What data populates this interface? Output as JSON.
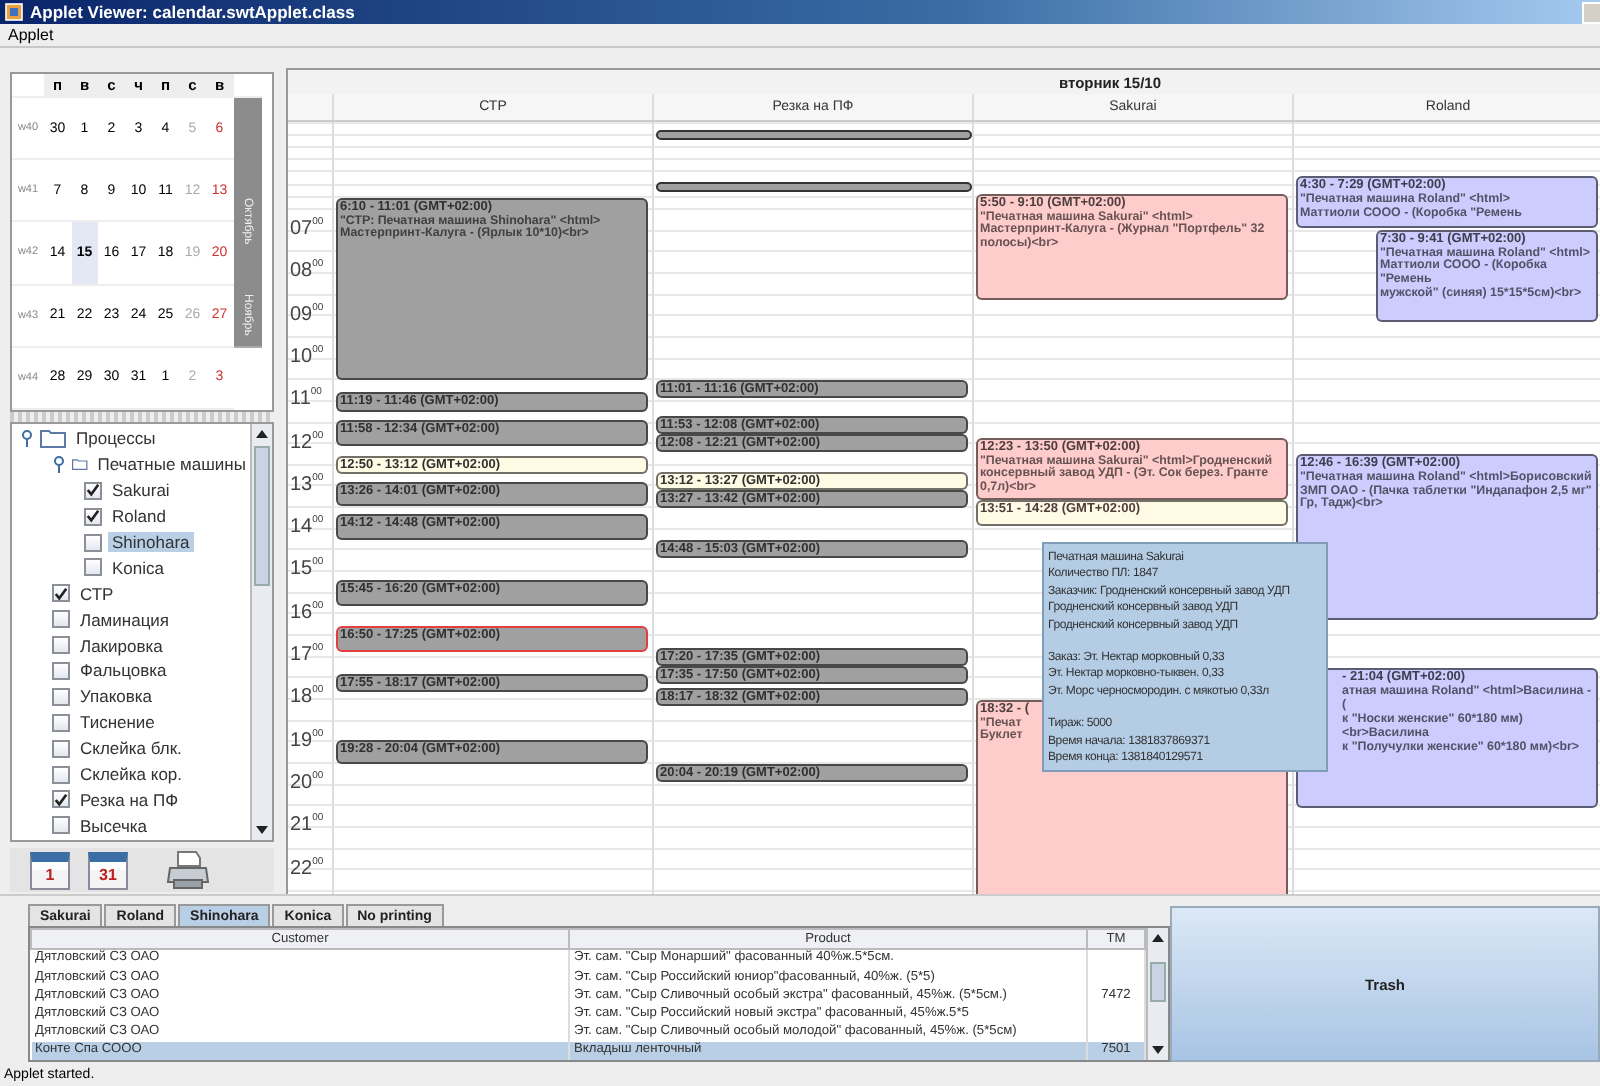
{
  "window": {
    "title": "Applet Viewer: calendar.swtApplet.class"
  },
  "menu": [
    "Applet"
  ],
  "calendar": {
    "weekdays": [
      "п",
      "в",
      "с",
      "ч",
      "п",
      "с",
      "в"
    ],
    "weeks": [
      {
        "label": "w40",
        "days": [
          {
            "day": "30",
            "selected": false
          },
          {
            "day": "1",
            "selected": false
          },
          {
            "day": "2",
            "selected": false
          },
          {
            "day": "3",
            "selected": false
          },
          {
            "day": "4",
            "selected": false
          },
          {
            "day": "5",
            "selected": false
          },
          {
            "day": "6",
            "selected": false
          }
        ]
      },
      {
        "label": "w41",
        "days": [
          {
            "day": "7",
            "selected": false
          },
          {
            "day": "8",
            "selected": false
          },
          {
            "day": "9",
            "selected": false
          },
          {
            "day": "10",
            "selected": false
          },
          {
            "day": "11",
            "selected": false
          },
          {
            "day": "12",
            "selected": false
          },
          {
            "day": "13",
            "selected": false
          }
        ]
      },
      {
        "label": "w42",
        "days": [
          {
            "day": "14",
            "selected": false
          },
          {
            "day": "15",
            "selected": true
          },
          {
            "day": "16",
            "selected": false
          },
          {
            "day": "17",
            "selected": false
          },
          {
            "day": "18",
            "selected": false
          },
          {
            "day": "19",
            "selected": false
          },
          {
            "day": "20",
            "selected": false
          }
        ]
      },
      {
        "label": "w43",
        "days": [
          {
            "day": "21",
            "selected": false
          },
          {
            "day": "22",
            "selected": false
          },
          {
            "day": "23",
            "selected": false
          },
          {
            "day": "24",
            "selected": false
          },
          {
            "day": "25",
            "selected": false
          },
          {
            "day": "26",
            "selected": false
          },
          {
            "day": "27",
            "selected": false
          }
        ]
      },
      {
        "label": "w44",
        "days": [
          {
            "day": "28",
            "selected": false
          },
          {
            "day": "29",
            "selected": false
          },
          {
            "day": "30",
            "selected": false
          },
          {
            "day": "31",
            "selected": false
          },
          {
            "day": "1",
            "selected": false
          },
          {
            "day": "2",
            "selected": false
          },
          {
            "day": "3",
            "selected": false
          }
        ]
      }
    ],
    "months": [
      {
        "label": "Октябрь"
      },
      {
        "label": "Ноябрь"
      }
    ]
  },
  "tree": {
    "items": [
      {
        "label": "Процессы",
        "kind": "folder",
        "expanded": true,
        "children": [
          {
            "label": "Печатные машины",
            "kind": "folder",
            "expanded": true,
            "children": [
              {
                "label": "Sakurai",
                "kind": "check",
                "checked": true,
                "selected": false
              },
              {
                "label": "Roland",
                "kind": "check",
                "checked": true,
                "selected": false
              },
              {
                "label": "Shinohara",
                "kind": "check",
                "checked": false,
                "selected": true
              },
              {
                "label": "Konica",
                "kind": "check",
                "checked": false,
                "selected": false
              }
            ]
          },
          {
            "label": "СТР",
            "kind": "check",
            "checked": true,
            "selected": false
          },
          {
            "label": "Ламинация",
            "kind": "check",
            "checked": false,
            "selected": false
          },
          {
            "label": "Лакировка",
            "kind": "check",
            "checked": false,
            "selected": false
          },
          {
            "label": "Фальцовка",
            "kind": "check",
            "checked": false,
            "selected": false
          },
          {
            "label": "Упаковка",
            "kind": "check",
            "checked": false,
            "selected": false
          },
          {
            "label": "Тиснение",
            "kind": "check",
            "checked": false,
            "selected": false
          },
          {
            "label": "Склейка блк.",
            "kind": "check",
            "checked": false,
            "selected": false
          },
          {
            "label": "Склейка кор.",
            "kind": "check",
            "checked": false,
            "selected": false
          },
          {
            "label": "Резка на ПФ",
            "kind": "check",
            "checked": true,
            "selected": false
          },
          {
            "label": "Высечка",
            "kind": "check",
            "checked": false,
            "selected": false
          }
        ]
      }
    ]
  },
  "toolbar": [
    {
      "kind": "calendar",
      "label": "1"
    },
    {
      "kind": "calendar",
      "label": "31"
    },
    {
      "kind": "printer"
    }
  ],
  "schedule": {
    "day": "вторник 15/10",
    "hours": [
      "07$^{00}$",
      "08$^{00}$",
      "09$^{00}$",
      "10$^{00}$",
      "11$^{00}$",
      "12$^{00}$",
      "13$^{00}$",
      "14$^{00}$",
      "15$^{00}$",
      "16$^{00}$",
      "17$^{00}$",
      "18$^{00}$",
      "19$^{00}$",
      "20$^{00}$",
      "21$^{00}$",
      "22$^{00}$"
    ],
    "columns": [
      {
        "title": "СТР",
        "color": "#a0a0a0",
        "events": [
          {
            "title": "6:10 - 11:01 (GMT+02:00)",
            "kind": "normal",
            "lines": [
              "\"СТР: Печатная машина Shinohara\" <html>",
              "Мастерпринт-Калуга - (Ярлык 10*10)<br>"
            ]
          },
          {
            "title": "11:19 - 11:46 (GMT+02:00)",
            "kind": "normal"
          },
          {
            "title": "11:58 - 12:34 (GMT+02:00)",
            "kind": "normal"
          },
          {
            "title": "12:50 - 13:12 (GMT+02:00)",
            "kind": "current"
          },
          {
            "title": "13:26 - 14:01 (GMT+02:00)",
            "kind": "normal"
          },
          {
            "title": "14:12 - 14:48 (GMT+02:00)",
            "kind": "normal"
          },
          {
            "title": "15:45 - 16:20 (GMT+02:00)",
            "kind": "normal"
          },
          {
            "title": "16:50 - 17:25 (GMT+02:00)",
            "kind": "warning"
          },
          {
            "title": "17:55 - 18:17 (GMT+02:00)",
            "kind": "normal"
          },
          {
            "title": "19:28 - 20:04 (GMT+02:00)",
            "kind": "normal"
          }
        ]
      },
      {
        "title": "Резка на ПФ",
        "color": "#a0a0a0",
        "markers": [
          {
            "kind": "bar"
          },
          {
            "kind": "bar"
          }
        ],
        "events": [
          {
            "title": "11:01 - 11:16 (GMT+02:00)",
            "kind": "normal"
          },
          {
            "title": "11:53 - 12:08 (GMT+02:00)",
            "kind": "normal"
          },
          {
            "title": "12:08 - 12:21 (GMT+02:00)",
            "kind": "normal"
          },
          {
            "title": "13:12 - 13:27 (GMT+02:00)",
            "kind": "current"
          },
          {
            "title": "13:27 - 13:42 (GMT+02:00)",
            "kind": "normal"
          },
          {
            "title": "14:48 - 15:03 (GMT+02:00)",
            "kind": "normal"
          },
          {
            "title": "17:20 - 17:35 (GMT+02:00)",
            "kind": "normal"
          },
          {
            "title": "17:35 - 17:50 (GMT+02:00)",
            "kind": "normal"
          },
          {
            "title": "18:17 - 18:32 (GMT+02:00)",
            "kind": "normal"
          },
          {
            "title": "20:04 - 20:19 (GMT+02:00)",
            "kind": "normal"
          }
        ]
      },
      {
        "title": "Sakurai",
        "color": "#ffcccc",
        "events": [
          {
            "title": "5:50 - 9:10 (GMT+02:00)",
            "kind": "normal",
            "lines": [
              "\"Печатная машина Sakurai\" <html>",
              "Мастерпринт-Калуга - (Журнал \"Портфель\" 32",
              "полосы)<br>"
            ]
          },
          {
            "title": "12:23 - 13:50 (GMT+02:00)",
            "kind": "normal",
            "lines": [
              "\"Печатная машина Sakurai\" <html>Гродненский",
              "консервный завод УДП - (Эт. Сок берез. Гранте",
              "0,7л)<br>"
            ]
          },
          {
            "title": "13:51 - 14:28 (GMT+02:00)",
            "kind": "current"
          },
          {
            "title": "18:32 - (",
            "kind": "normal",
            "lines": [
              "\"Печат",
              "Буклет"
            ]
          }
        ]
      },
      {
        "title": "Roland",
        "color": "#ccccff",
        "events": [
          {
            "title": "4:30 - 7:29 (GMT+02:00)",
            "kind": "normal",
            "lines": [
              "\"Печатная машина Roland\" <html>",
              "Маттиоли СООО - (Коробка \"Ремень"
            ]
          },
          {
            "title": "7:30 - 9:41 (GMT+02:00)",
            "kind": "normal",
            "overlap": true,
            "lines": [
              "\"Печатная машина Roland\" <html>",
              "Маттиоли СООО - (Коробка \"Ремень",
              "мужской\" (синяя) 15*15*5см)<br>"
            ]
          },
          {
            "title": "12:46 - 16:39 (GMT+02:00)",
            "kind": "normal",
            "lines": [
              "\"Печатная машина Roland\" <html>Борисовский",
              "ЗМП ОАО - (Пачка таблетки \"Индапафон 2,5 мг\"",
              "Гр, Тадж)<br>"
            ]
          },
          {
            "title": "- 21:04 (GMT+02:00)",
            "kind": "normal",
            "covered": true,
            "lines": [
              "атная машина Roland\" <html>Василина - (",
              "к \"Носки женские\" 60*180 мм)<br>Василина",
              "к \"Получулки женские\" 60*180 мм)<br>"
            ]
          }
        ]
      }
    ],
    "tooltip": {
      "groups": [
        [
          "Печатная машина Sakurai",
          "Количество ПЛ: 1847",
          "Заказчик: Гродненский консервный завод УДП",
          "Гродненский консервный завод УДП",
          "Гродненский консервный завод УДП"
        ],
        [
          "Заказ: Эт. Нектар морковный 0,33",
          "Эт. Нектар морковно-тыквен. 0,33",
          "Эт. Морс черносмородин. с мякотью 0,33л"
        ],
        [
          "Тираж: 5000",
          "Время начала: 1381837869371",
          "Время конца: 1381840129571"
        ]
      ]
    }
  },
  "bottom": {
    "tabs": [
      {
        "label": "Sakurai",
        "selected": false
      },
      {
        "label": "Roland",
        "selected": false
      },
      {
        "label": "Shinohara",
        "selected": true
      },
      {
        "label": "Konica",
        "selected": false
      },
      {
        "label": "No printing",
        "selected": false
      }
    ],
    "table": {
      "columns": [
        "Customer",
        "Product",
        "TM"
      ],
      "groups": [
        {
          "tm": "7472",
          "rows": [
            {
              "customer": "Дятловский СЗ ОАО",
              "product": "Эт. сам. \"Сыр Монарший\" фасованный 40%ж.5*5см.",
              "selected": false
            },
            {
              "customer": "Дятловский СЗ ОАО",
              "product": "Эт. сам. \"Сыр Российский юниор\"фасованный, 40%ж. (5*5)",
              "selected": false
            },
            {
              "customer": "Дятловский СЗ ОАО",
              "product": "Эт. сам. \"Сыр Сливочный особый экстра\" фасованный, 45%ж. (5*5см.)",
              "selected": false
            },
            {
              "customer": "Дятловский СЗ ОАО",
              "product": "Эт. сам. \"Сыр Российский новый экстра\" фасованный, 45%ж.5*5",
              "selected": false
            },
            {
              "customer": "Дятловский СЗ ОАО",
              "product": "Эт. сам. \"Сыр Сливочный особый молодой\" фасованный, 45%ж. (5*5см)",
              "selected": false
            }
          ]
        },
        {
          "tm": "7501",
          "rows": [
            {
              "customer": "Конте Спа СООО",
              "product": "Вкладыш ленточный",
              "selected": true
            }
          ]
        }
      ]
    },
    "trash": "Trash"
  },
  "status_bar": "Applet started."
}
